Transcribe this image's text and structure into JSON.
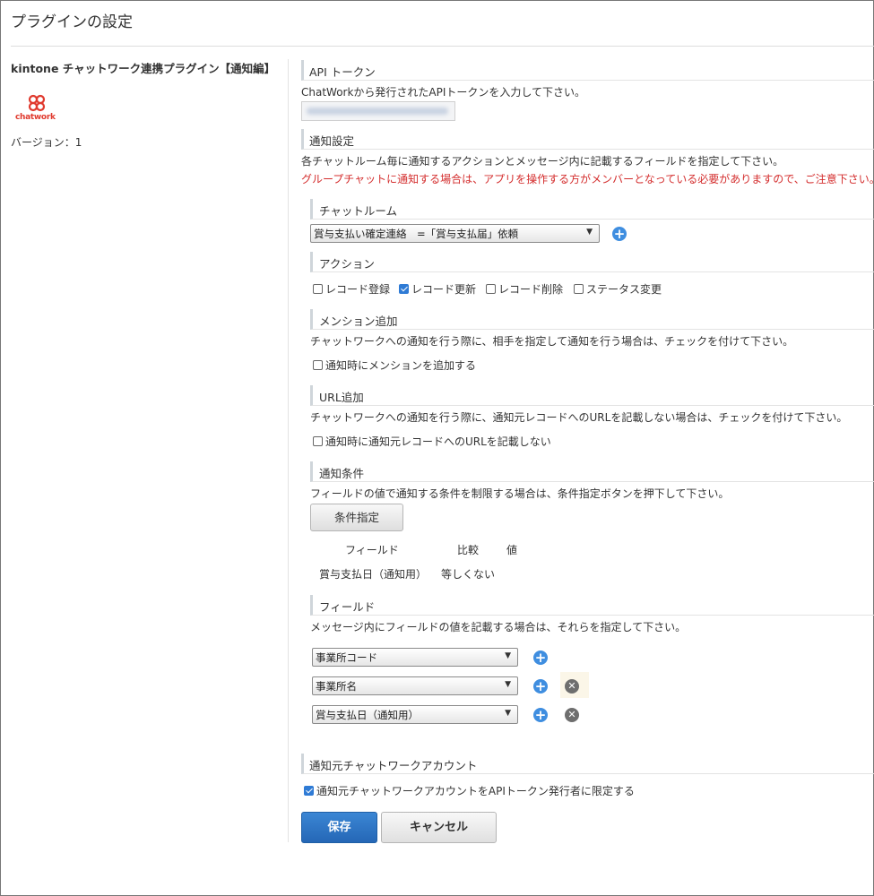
{
  "page": {
    "title": "プラグインの設定"
  },
  "sidebar": {
    "plugin_name": "kintone チャットワーク連携プラグイン【通知編】",
    "logo_text": "chatwork",
    "version": "バージョン：1"
  },
  "api_token": {
    "heading": "API トークン",
    "description": "ChatWorkから発行されたAPIトークンを入力して下さい。"
  },
  "notify": {
    "heading": "通知設定",
    "description": "各チャットルーム毎に通知するアクションとメッセージ内に記載するフィールドを指定して下さい。",
    "warning": "グループチャットに通知する場合は、アプリを操作する方がメンバーとなっている必要がありますので、ご注意下さい。",
    "warning_color": "#d42e2e"
  },
  "chatroom": {
    "heading": "チャットルーム",
    "selected": "賞与支払い確定連絡　=「賞与支払届」依頼"
  },
  "action": {
    "heading": "アクション",
    "options": [
      {
        "label": "レコード登録",
        "checked": false
      },
      {
        "label": "レコード更新",
        "checked": true
      },
      {
        "label": "レコード削除",
        "checked": false
      },
      {
        "label": "ステータス変更",
        "checked": false
      }
    ]
  },
  "mention": {
    "heading": "メンション追加",
    "description": "チャットワークへの通知を行う際に、相手を指定して通知を行う場合は、チェックを付けて下さい。",
    "checkbox_label": "通知時にメンションを追加する"
  },
  "url_add": {
    "heading": "URL追加",
    "description": "チャットワークへの通知を行う際に、通知元レコードへのURLを記載しない場合は、チェックを付けて下さい。",
    "checkbox_label": "通知時に通知元レコードへのURLを記載しない"
  },
  "condition": {
    "heading": "通知条件",
    "description": "フィールドの値で通知する条件を制限する場合は、条件指定ボタンを押下して下さい。",
    "button_label": "条件指定",
    "columns": [
      "フィールド",
      "比較",
      "値"
    ],
    "rows": [
      {
        "field": "賞与支払日（通知用）",
        "compare": "等しくない",
        "value": ""
      }
    ]
  },
  "fields": {
    "heading": "フィールド",
    "description": "メッセージ内にフィールドの値を記載する場合は、それらを指定して下さい。",
    "items": [
      "事業所コード",
      "事業所名",
      "賞与支払日（通知用）"
    ]
  },
  "source_account": {
    "heading": "通知元チャットワークアカウント",
    "checkbox_label": "通知元チャットワークアカウントをAPIトークン発行者に限定する",
    "checked": true
  },
  "buttons": {
    "save": "保存",
    "cancel": "キャンセル"
  },
  "colors": {
    "accent": "#2f7bd5",
    "save_bg": "#2567b6"
  }
}
